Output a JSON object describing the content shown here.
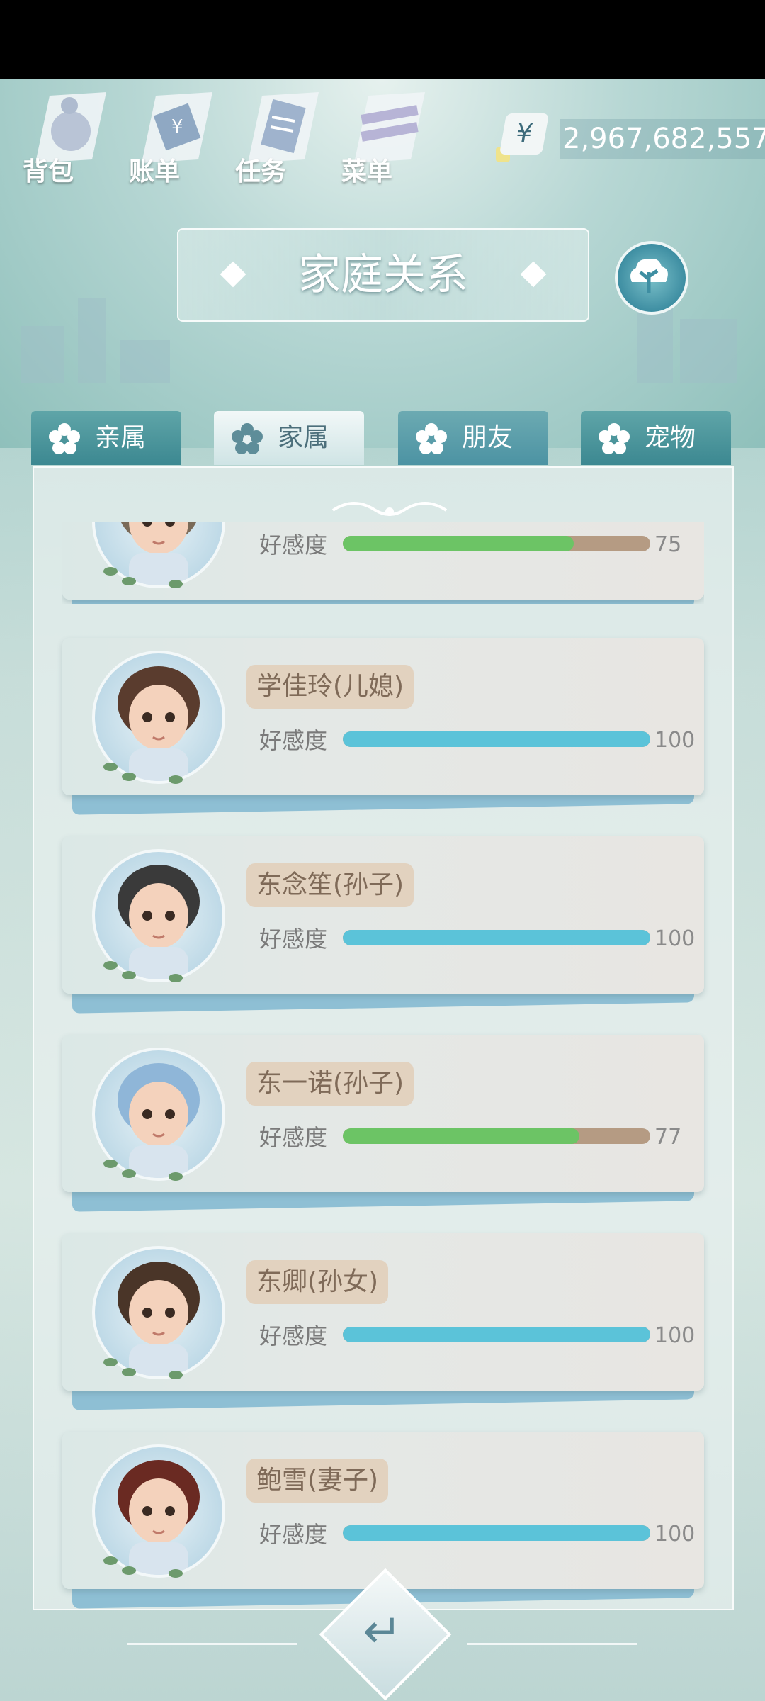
{
  "top_menu": [
    {
      "label": "背包"
    },
    {
      "label": "账单"
    },
    {
      "label": "任务"
    },
    {
      "label": "菜单"
    }
  ],
  "currency": {
    "symbol": "¥",
    "amount": "2,967,682,557"
  },
  "title": "家庭关系",
  "tabs": [
    {
      "label": "亲属",
      "state": "inactive"
    },
    {
      "label": "家属",
      "state": "active"
    },
    {
      "label": "朋友",
      "state": "inactive"
    },
    {
      "label": "宠物",
      "state": "inactive"
    }
  ],
  "affinity_label": "好感度",
  "members": [
    {
      "name": "",
      "value": "75",
      "ratio": 0.75,
      "color": "#6cc465"
    },
    {
      "name": "学佳玲(儿媳)",
      "value": "100",
      "ratio": 1.0,
      "color": "#5bc3d9"
    },
    {
      "name": "东念笙(孙子)",
      "value": "100",
      "ratio": 1.0,
      "color": "#5bc3d9"
    },
    {
      "name": "东一诺(孙子)",
      "value": "77",
      "ratio": 0.77,
      "color": "#6cc465"
    },
    {
      "name": "东卿(孙女)",
      "value": "100",
      "ratio": 1.0,
      "color": "#5bc3d9"
    },
    {
      "name": "鲍雪(妻子)",
      "value": "100",
      "ratio": 1.0,
      "color": "#5bc3d9"
    }
  ],
  "colors": {
    "accent": "#3e8ea2",
    "bar_full": "#5bc3d9",
    "bar_partial": "#6cc465",
    "bar_track": "#b59b83"
  }
}
